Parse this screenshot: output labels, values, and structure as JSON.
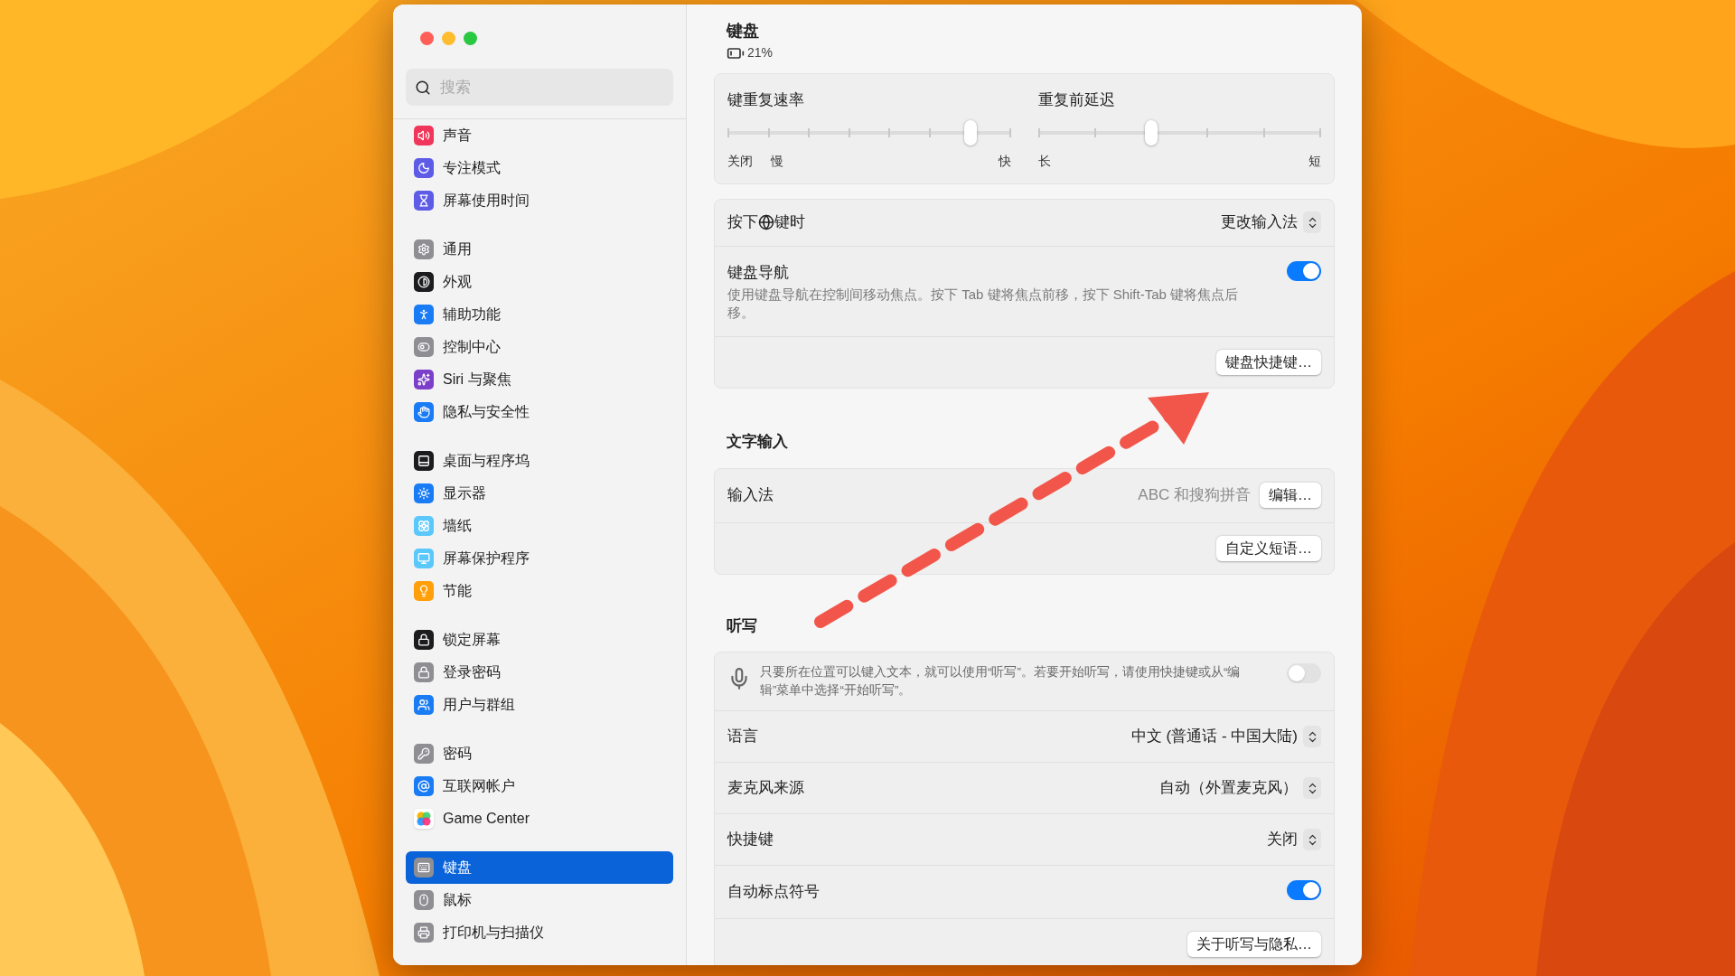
{
  "sidebar": {
    "search": {
      "placeholder": "搜索"
    },
    "groups": [
      [
        {
          "label": "声音",
          "kind": "sound",
          "color": "#f0365a",
          "selected": false
        },
        {
          "label": "专注模式",
          "kind": "moon",
          "color": "#5e5ce6",
          "selected": false
        },
        {
          "label": "屏幕使用时间",
          "kind": "hourglass",
          "color": "#5e5ce6",
          "selected": false
        }
      ],
      [
        {
          "label": "通用",
          "kind": "gear",
          "color": "#8e8e93",
          "selected": false
        },
        {
          "label": "外观",
          "kind": "contrast",
          "color": "#1c1c1e",
          "selected": false
        },
        {
          "label": "辅助功能",
          "kind": "person",
          "color": "#1a7cf5",
          "selected": false
        },
        {
          "label": "控制中心",
          "kind": "toggles",
          "color": "#8e8e93",
          "selected": false
        },
        {
          "label": "Siri 与聚焦",
          "kind": "sparkle",
          "color": "#7b3fc9",
          "selected": false
        },
        {
          "label": "隐私与安全性",
          "kind": "hand",
          "color": "#1a7cf5",
          "selected": false
        }
      ],
      [
        {
          "label": "桌面与程序坞",
          "kind": "dock",
          "color": "#1c1c1e",
          "selected": false
        },
        {
          "label": "显示器",
          "kind": "sun",
          "color": "#1a7cf5",
          "selected": false
        },
        {
          "label": "墙纸",
          "kind": "flower",
          "color": "#5ac8fa",
          "selected": false
        },
        {
          "label": "屏幕保护程序",
          "kind": "screen",
          "color": "#5ac8fa",
          "selected": false
        },
        {
          "label": "节能",
          "kind": "bulb",
          "color": "#ff9f0a",
          "selected": false
        }
      ],
      [
        {
          "label": "锁定屏幕",
          "kind": "lock",
          "color": "#1c1c1e",
          "selected": false
        },
        {
          "label": "登录密码",
          "kind": "lock",
          "color": "#8e8e93",
          "selected": false
        },
        {
          "label": "用户与群组",
          "kind": "users",
          "color": "#1a7cf5",
          "selected": false
        }
      ],
      [
        {
          "label": "密码",
          "kind": "key",
          "color": "#8e8e93",
          "selected": false
        },
        {
          "label": "互联网帐户",
          "kind": "at",
          "color": "#1a7cf5",
          "selected": false
        },
        {
          "label": "Game Center",
          "kind": "bubbles",
          "color": "#ffffff",
          "selected": false
        }
      ],
      [
        {
          "label": "键盘",
          "kind": "keyboard",
          "color": "#8e8e93",
          "selected": true
        },
        {
          "label": "鼠标",
          "kind": "mouse",
          "color": "#8e8e93",
          "selected": false
        },
        {
          "label": "打印机与扫描仪",
          "kind": "printer",
          "color": "#8e8e93",
          "selected": false
        }
      ]
    ]
  },
  "header": {
    "title": "键盘",
    "battery": "21%"
  },
  "sliders": [
    {
      "label": "键重复速率",
      "kind": "rate",
      "level": 0.857,
      "left_labels": [
        "关闭",
        "慢"
      ],
      "right_labels": [
        "快"
      ]
    },
    {
      "label": "重复前延迟",
      "kind": "delay",
      "level": 0.4,
      "left_labels": [
        "长"
      ],
      "right_labels": [
        "短"
      ]
    }
  ],
  "keyboard_card": [
    {
      "kind": "globe_select",
      "label_parts": [
        "按下",
        "键时"
      ],
      "value": "更改输入法"
    },
    {
      "kind": "toggle",
      "label": "键盘导航",
      "description": "使用键盘导航在控制间移动焦点。按下 Tab 键将焦点前移，按下 Shift-Tab 键将焦点后移。",
      "on": true
    },
    {
      "kind": "button",
      "label": "键盘快捷键…"
    }
  ],
  "text_input": {
    "heading": "文字输入",
    "rows": [
      {
        "kind": "value_button",
        "label": "输入法",
        "value": "ABC 和搜狗拼音",
        "button": "编辑…"
      },
      {
        "kind": "button",
        "label": "自定义短语…"
      }
    ]
  },
  "dictation": {
    "heading": "听写",
    "rows": [
      {
        "kind": "intro",
        "description": "只要所在位置可以键入文本，就可以使用“听写”。若要开始听写，请使用快捷键或从“编辑”菜单中选择“开始听写”。",
        "on": false
      },
      {
        "kind": "select",
        "label": "语言",
        "value": "中文 (普通话 - 中国大陆)"
      },
      {
        "kind": "select",
        "label": "麦克风来源",
        "value": "自动（外置麦克风）"
      },
      {
        "kind": "select",
        "label": "快捷键",
        "value": "关闭"
      },
      {
        "kind": "toggle",
        "label": "自动标点符号",
        "on": true
      },
      {
        "kind": "button",
        "label": "关于听写与隐私…"
      }
    ]
  }
}
